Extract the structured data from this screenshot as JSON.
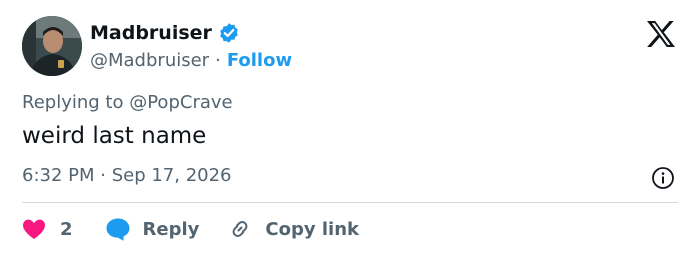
{
  "author": {
    "display_name": "Madbruiser",
    "handle": "@Madbruiser",
    "separator": "·",
    "follow_label": "Follow",
    "verified": true
  },
  "reply_context": {
    "prefix": "Replying to",
    "mention": "@PopCrave"
  },
  "tweet": {
    "text": "weird last name",
    "timestamp": "6:32 PM · Sep 17, 2026"
  },
  "actions": {
    "like_count": "2",
    "reply_label": "Reply",
    "copy_link_label": "Copy link"
  },
  "icons": {
    "brand": "x-logo-icon",
    "verified": "verified-badge-icon",
    "info": "info-icon",
    "like": "heart-icon",
    "reply": "speech-bubble-icon",
    "copy_link": "link-icon"
  },
  "colors": {
    "text": "#0f1419",
    "secondary": "#536471",
    "accent": "#1d9bf0",
    "like": "#f91880",
    "divider": "#cfd9de"
  }
}
